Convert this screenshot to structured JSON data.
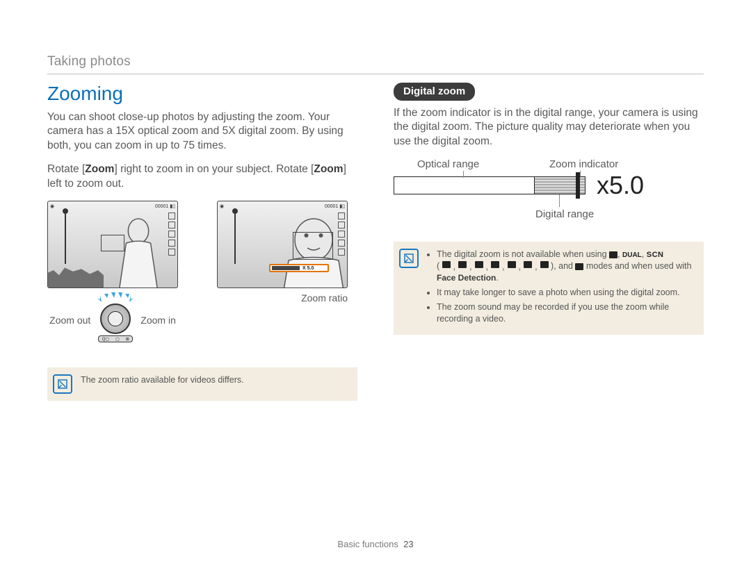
{
  "breadcrumb": "Taking photos",
  "left": {
    "heading": "Zooming",
    "intro": "You can shoot close-up photos by adjusting the zoom. Your camera has a 15X optical zoom and 5X digital zoom. By using both, you can zoom in up to 75 times.",
    "rotate_pre": "Rotate [",
    "rotate_zoom": "Zoom",
    "rotate_mid": "] right to zoom in on your subject. Rotate [",
    "rotate_zoom2": "Zoom",
    "rotate_post": "] left to zoom out.",
    "lcd_counter": "00001",
    "zoom_bar_label": "X 5.0",
    "label_zoom_out": "Zoom out",
    "label_zoom_in": "Zoom in",
    "label_zoom_ratio": "Zoom ratio",
    "note": "The zoom ratio available for videos differs."
  },
  "right": {
    "pill": "Digital zoom",
    "intro": "If the zoom indicator is in the digital range, your camera is using the digital zoom. The picture quality may deteriorate when you use the digital zoom.",
    "diagram": {
      "optical_range": "Optical range",
      "zoom_indicator": "Zoom indicator",
      "digital_range": "Digital range",
      "x_value": "x5.0"
    },
    "note_items": {
      "item1_pre": "The digital zoom is not available when using ",
      "item1_mid": "( ",
      "item1_post": " ), and ",
      "item1_end": " modes and when used with ",
      "face_detection": "Face Detection",
      "item1_period": ".",
      "dual_label": "DUAL",
      "scn_label": "SCN",
      "item2": "It may take longer to save a photo when using the digital zoom.",
      "item3": "The zoom sound may be recorded if you use the zoom while recording a video."
    }
  },
  "footer": {
    "section": "Basic functions",
    "page": "23"
  }
}
